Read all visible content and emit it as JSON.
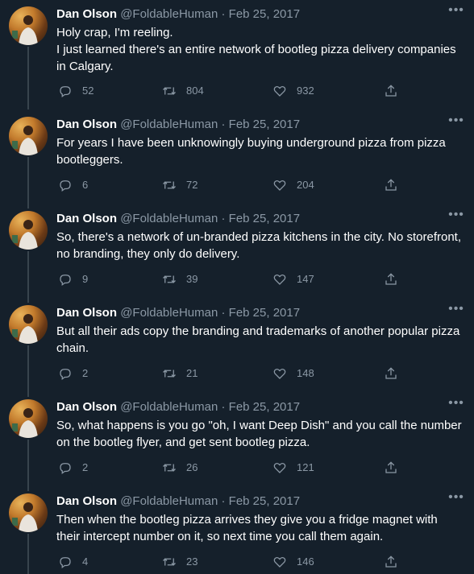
{
  "author": {
    "name": "Dan Olson",
    "handle": "@FoldableHuman",
    "separator": "·",
    "date": "Feb 25, 2017"
  },
  "more_glyph": "•••",
  "icons": {
    "reply": "reply-icon",
    "retweet": "retweet-icon",
    "like": "heart-icon",
    "share": "share-icon"
  },
  "tweets": [
    {
      "text": "Holy crap, I'm reeling.\nI just learned there's an entire network of bootleg pizza delivery companies in Calgary.",
      "replies": "52",
      "retweets": "804",
      "likes": "932"
    },
    {
      "text": "For years I have been unknowingly buying underground pizza from pizza bootleggers.",
      "replies": "6",
      "retweets": "72",
      "likes": "204"
    },
    {
      "text": "So, there's a network of un-branded pizza kitchens in the city. No storefront, no branding, they only do delivery.",
      "replies": "9",
      "retweets": "39",
      "likes": "147"
    },
    {
      "text": "But all their ads copy the branding and trademarks of another popular pizza chain.",
      "replies": "2",
      "retweets": "21",
      "likes": "148"
    },
    {
      "text": "So, what happens is you go \"oh, I want Deep Dish\" and you call the number on the bootleg flyer, and get sent bootleg pizza.",
      "replies": "2",
      "retweets": "26",
      "likes": "121"
    },
    {
      "text": "Then when the bootleg pizza arrives they give you a fridge magnet with their intercept number on it, so next time you call them again.",
      "replies": "4",
      "retweets": "23",
      "likes": "146"
    }
  ]
}
